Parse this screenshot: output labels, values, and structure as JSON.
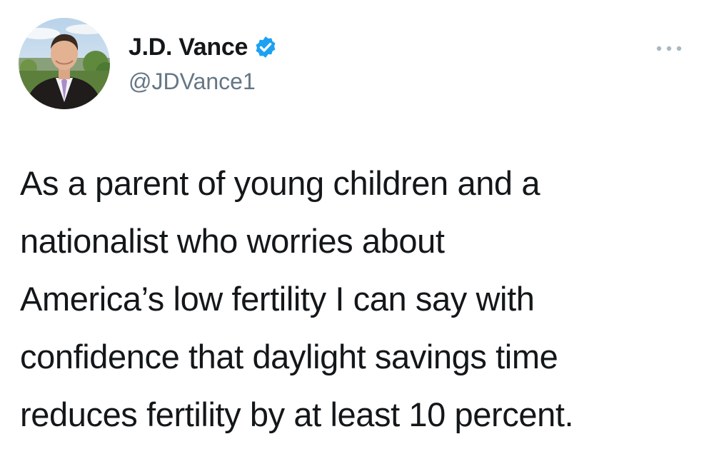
{
  "tweet": {
    "author": {
      "display_name": "J.D. Vance",
      "handle": "@JDVance1",
      "verified": true,
      "avatar_icon": "profile-photo"
    },
    "more_icon": "more-options-icon",
    "text_lines": [
      "As a parent of young children and a",
      "nationalist who worries about",
      "America’s low fertility I can say with",
      "confidence that daylight savings time",
      "reduces fertility by at least 10 percent."
    ]
  },
  "colors": {
    "verified_badge": "#1da1f2",
    "handle_text": "#657786",
    "body_text": "#14171a",
    "more_dots": "#aab8c2"
  }
}
